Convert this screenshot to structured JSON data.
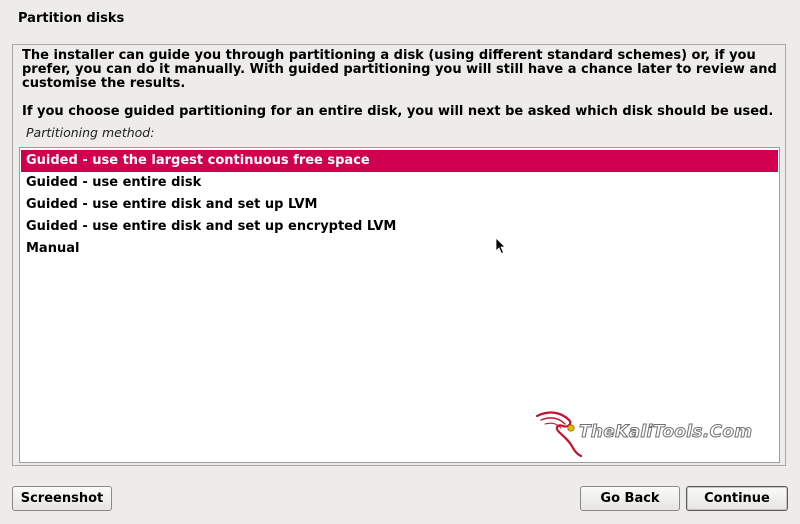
{
  "window": {
    "title": "Partition disks"
  },
  "main": {
    "description": "The installer can guide you through partitioning a disk (using different standard schemes) or, if you prefer, you can do it manually. With guided partitioning you will still have a chance later to review and customise the results.",
    "description2": "If you choose guided partitioning for an entire disk, you will next be asked which disk should be used.",
    "method_label": "Partitioning method:",
    "options": [
      {
        "label": "Guided - use the largest continuous free space",
        "selected": true
      },
      {
        "label": "Guided - use entire disk",
        "selected": false
      },
      {
        "label": "Guided - use entire disk and set up LVM",
        "selected": false
      },
      {
        "label": "Guided - use entire disk and set up encrypted LVM",
        "selected": false
      },
      {
        "label": "Manual",
        "selected": false
      }
    ]
  },
  "watermark": {
    "text": "TheKaliTools.Com"
  },
  "buttons": {
    "screenshot": "Screenshot",
    "back": "Go Back",
    "continue": "Continue"
  },
  "colors": {
    "selection": "#d0004f",
    "background": "#edeceb",
    "list_background": "#ffffff"
  },
  "icons": {
    "cursor": "mouse-pointer-icon",
    "watermark_logo": "kali-dragon-icon"
  }
}
